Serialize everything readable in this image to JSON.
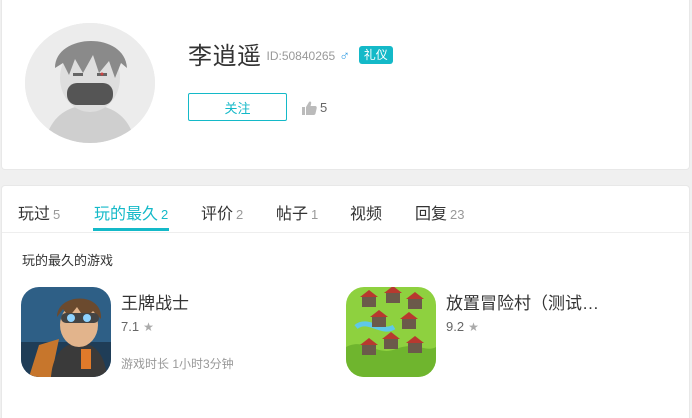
{
  "profile": {
    "username": "李逍遥",
    "user_id": "ID:50840265",
    "gender_symbol": "♂",
    "badge": "礼仪",
    "follow_label": "关注",
    "likes": "5"
  },
  "tabs": [
    {
      "label": "玩过",
      "count": "5"
    },
    {
      "label": "玩的最久",
      "count": "2"
    },
    {
      "label": "评价",
      "count": "2"
    },
    {
      "label": "帖子",
      "count": "1"
    },
    {
      "label": "视频",
      "count": ""
    },
    {
      "label": "回复",
      "count": "23"
    }
  ],
  "active_tab": "玩的最久",
  "section_title": "玩的最久的游戏",
  "games": [
    {
      "name": "王牌战士",
      "score": "7.1",
      "playtime": "游戏时长 1小时3分钟"
    },
    {
      "name": "放置冒险村（测试…",
      "score": "9.2",
      "playtime": ""
    }
  ],
  "colors": {
    "accent": "#14b9c8",
    "gender": "#2f9be3"
  }
}
